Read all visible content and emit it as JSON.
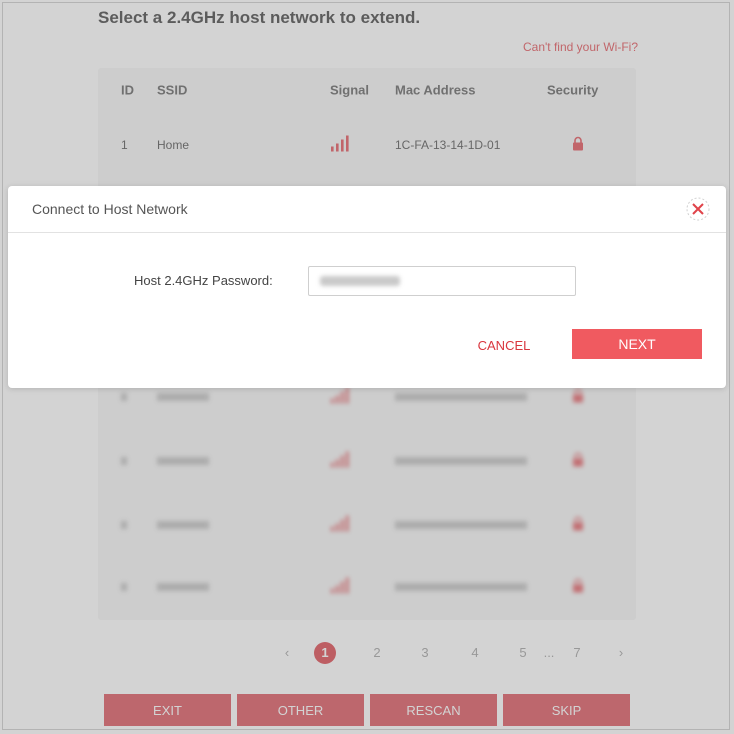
{
  "page": {
    "title": "Select a 2.4GHz host network to extend.",
    "cant_find_link": "Can't find your Wi-Fi?"
  },
  "table": {
    "headers": {
      "id": "ID",
      "ssid": "SSID",
      "signal": "Signal",
      "mac": "Mac Address",
      "security": "Security"
    },
    "rows": [
      {
        "id": "1",
        "ssid": "Home",
        "mac": "1C-FA-13-14-1D-01",
        "secured": true,
        "blurred": false
      },
      {
        "id": "",
        "ssid": "",
        "mac": "",
        "secured": true,
        "blurred": true
      },
      {
        "id": "",
        "ssid": "",
        "mac": "",
        "secured": true,
        "blurred": true
      },
      {
        "id": "",
        "ssid": "",
        "mac": "",
        "secured": true,
        "blurred": true
      },
      {
        "id": "",
        "ssid": "",
        "mac": "",
        "secured": true,
        "blurred": true
      },
      {
        "id": "",
        "ssid": "",
        "mac": "",
        "secured": true,
        "blurred": true
      },
      {
        "id": "",
        "ssid": "",
        "mac": "",
        "secured": true,
        "blurred": true
      },
      {
        "id": "",
        "ssid": "",
        "mac": "",
        "secured": true,
        "blurred": true
      }
    ]
  },
  "pagination": {
    "pages": [
      "1",
      "2",
      "3",
      "4",
      "5"
    ],
    "ellipsis": "...",
    "last": "7",
    "active": "1"
  },
  "footer": {
    "exit": "EXIT",
    "other": "OTHER",
    "rescan": "RESCAN",
    "skip": "SKIP"
  },
  "modal": {
    "title": "Connect to Host Network",
    "password_label": "Host 2.4GHz Password:",
    "password_value": "",
    "cancel": "CANCEL",
    "next": "NEXT"
  },
  "colors": {
    "accent": "#d9363e",
    "button": "#d94550",
    "next": "#f05a60",
    "icon": "close-icon"
  }
}
